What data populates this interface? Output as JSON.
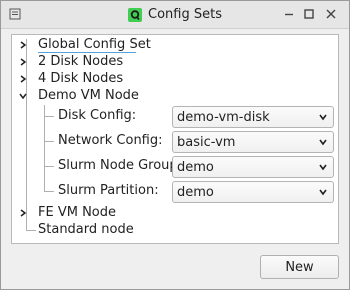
{
  "window": {
    "title": "Config Sets",
    "app_icon": "qt-creator-icon",
    "buttons": [
      "menu-icon",
      "minimize-icon",
      "maximize-icon",
      "close-icon"
    ]
  },
  "tree": {
    "items": [
      {
        "label": "Global Config Set",
        "expanded": false
      },
      {
        "label": "2 Disk Nodes",
        "expanded": false
      },
      {
        "label": "4 Disk Nodes",
        "expanded": false
      },
      {
        "label": "Demo VM Node",
        "expanded": true
      },
      {
        "label": "FE VM Node",
        "expanded": false
      },
      {
        "label": "Standard node",
        "expanded": false
      }
    ],
    "demo_vm_node": {
      "fields": [
        {
          "label": "Disk Config:",
          "value": "demo-vm-disk"
        },
        {
          "label": "Network Config:",
          "value": "basic-vm"
        },
        {
          "label": "Slurm Node Group:",
          "value": "demo"
        },
        {
          "label": "Slurm Partition:",
          "value": "demo"
        }
      ]
    }
  },
  "actions": {
    "new_label": "New"
  }
}
